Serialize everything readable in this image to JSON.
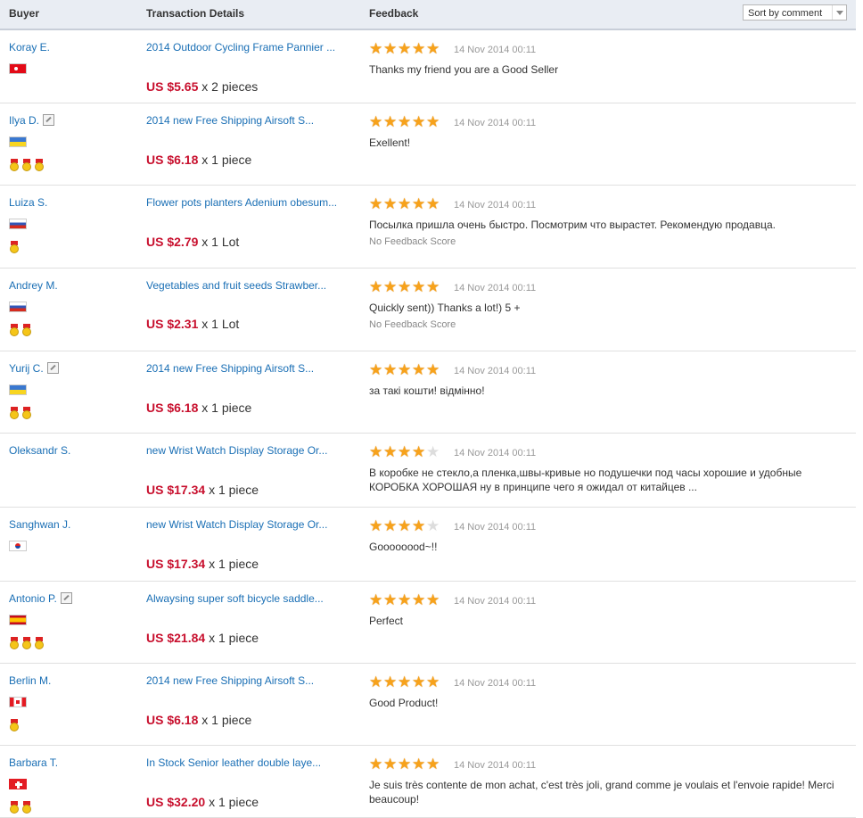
{
  "header": {
    "buyer": "Buyer",
    "transaction": "Transaction Details",
    "feedback": "Feedback",
    "sort_label": "Sort by comment"
  },
  "colors": {
    "link": "#1a6fb5",
    "price": "#c8102e",
    "star": "#f7a21b"
  },
  "rows": [
    {
      "buyer": "Koray E.",
      "flag": "turkey",
      "medals": 0,
      "edit": false,
      "product": "2014 Outdoor Cycling Frame Pannier ...",
      "price": "US $5.65",
      "qty": "x 2 pieces",
      "stars": 5,
      "date": "14 Nov 2014 00:11",
      "comment": "Thanks my friend you are a Good Seller",
      "no_score": ""
    },
    {
      "buyer": "Ilya D.",
      "flag": "ukraine",
      "medals": 3,
      "edit": true,
      "product": "2014 new Free Shipping Airsoft S...",
      "price": "US $6.18",
      "qty": "x 1 piece",
      "stars": 5,
      "date": "14 Nov 2014 00:11",
      "comment": "Exellent!",
      "no_score": ""
    },
    {
      "buyer": "Luiza S.",
      "flag": "russia",
      "medals": 1,
      "edit": false,
      "product": "Flower pots planters Adenium obesum...",
      "price": "US $2.79",
      "qty": "x 1 Lot",
      "stars": 5,
      "date": "14 Nov 2014 00:11",
      "comment": "Посылка пришла очень быстро. Посмотрим что вырастет. Рекомендую продавца.",
      "no_score": "No Feedback Score"
    },
    {
      "buyer": "Andrey M.",
      "flag": "russia",
      "medals": 2,
      "edit": false,
      "product": "Vegetables and fruit seeds Strawber...",
      "price": "US $2.31",
      "qty": "x 1 Lot",
      "stars": 5,
      "date": "14 Nov 2014 00:11",
      "comment": "Quickly sent)) Thanks a lot!) 5 +",
      "no_score": "No Feedback Score"
    },
    {
      "buyer": "Yurij C.",
      "flag": "ukraine",
      "medals": 2,
      "edit": true,
      "product": "2014 new Free Shipping Airsoft S...",
      "price": "US $6.18",
      "qty": "x 1 piece",
      "stars": 5,
      "date": "14 Nov 2014 00:11",
      "comment": "за такі кошти! відмінно!",
      "no_score": ""
    },
    {
      "buyer": "Oleksandr S.",
      "flag": "",
      "medals": 0,
      "edit": false,
      "product": "new Wrist Watch Display Storage Or...",
      "price": "US $17.34",
      "qty": "x 1 piece",
      "stars": 4,
      "date": "14 Nov 2014 00:11",
      "comment": "В коробке не стекло,а пленка,швы-кривые но подушечки под часы хорошие и удобные КОРОБКА ХОРОШАЯ ну в принципе чего я ожидал от китайцев ...",
      "no_score": ""
    },
    {
      "buyer": "Sanghwan J.",
      "flag": "korea",
      "medals": 0,
      "edit": false,
      "product": "new Wrist Watch Display Storage Or...",
      "price": "US $17.34",
      "qty": "x 1 piece",
      "stars": 4,
      "date": "14 Nov 2014 00:11",
      "comment": "Goooooood~!!",
      "no_score": ""
    },
    {
      "buyer": "Antonio P.",
      "flag": "spain",
      "medals": 3,
      "edit": true,
      "product": "Alwaysing super soft bicycle saddle...",
      "price": "US $21.84",
      "qty": "x 1 piece",
      "stars": 5,
      "date": "14 Nov 2014 00:11",
      "comment": "Perfect",
      "no_score": ""
    },
    {
      "buyer": "Berlin M.",
      "flag": "canada",
      "medals": 1,
      "edit": false,
      "product": "2014 new Free Shipping Airsoft S...",
      "price": "US $6.18",
      "qty": "x 1 piece",
      "stars": 5,
      "date": "14 Nov 2014 00:11",
      "comment": "Good Product!",
      "no_score": ""
    },
    {
      "buyer": "Barbara T.",
      "flag": "switzerland",
      "medals": 2,
      "edit": false,
      "product": "In Stock Senior leather double laye...",
      "price": "US $32.20",
      "qty": "x 1 piece",
      "stars": 5,
      "date": "14 Nov 2014 00:11",
      "comment": "Je suis très contente de mon achat, c'est très joli, grand comme je voulais et l'envoie rapide! Merci beaucoup!",
      "no_score": ""
    }
  ]
}
